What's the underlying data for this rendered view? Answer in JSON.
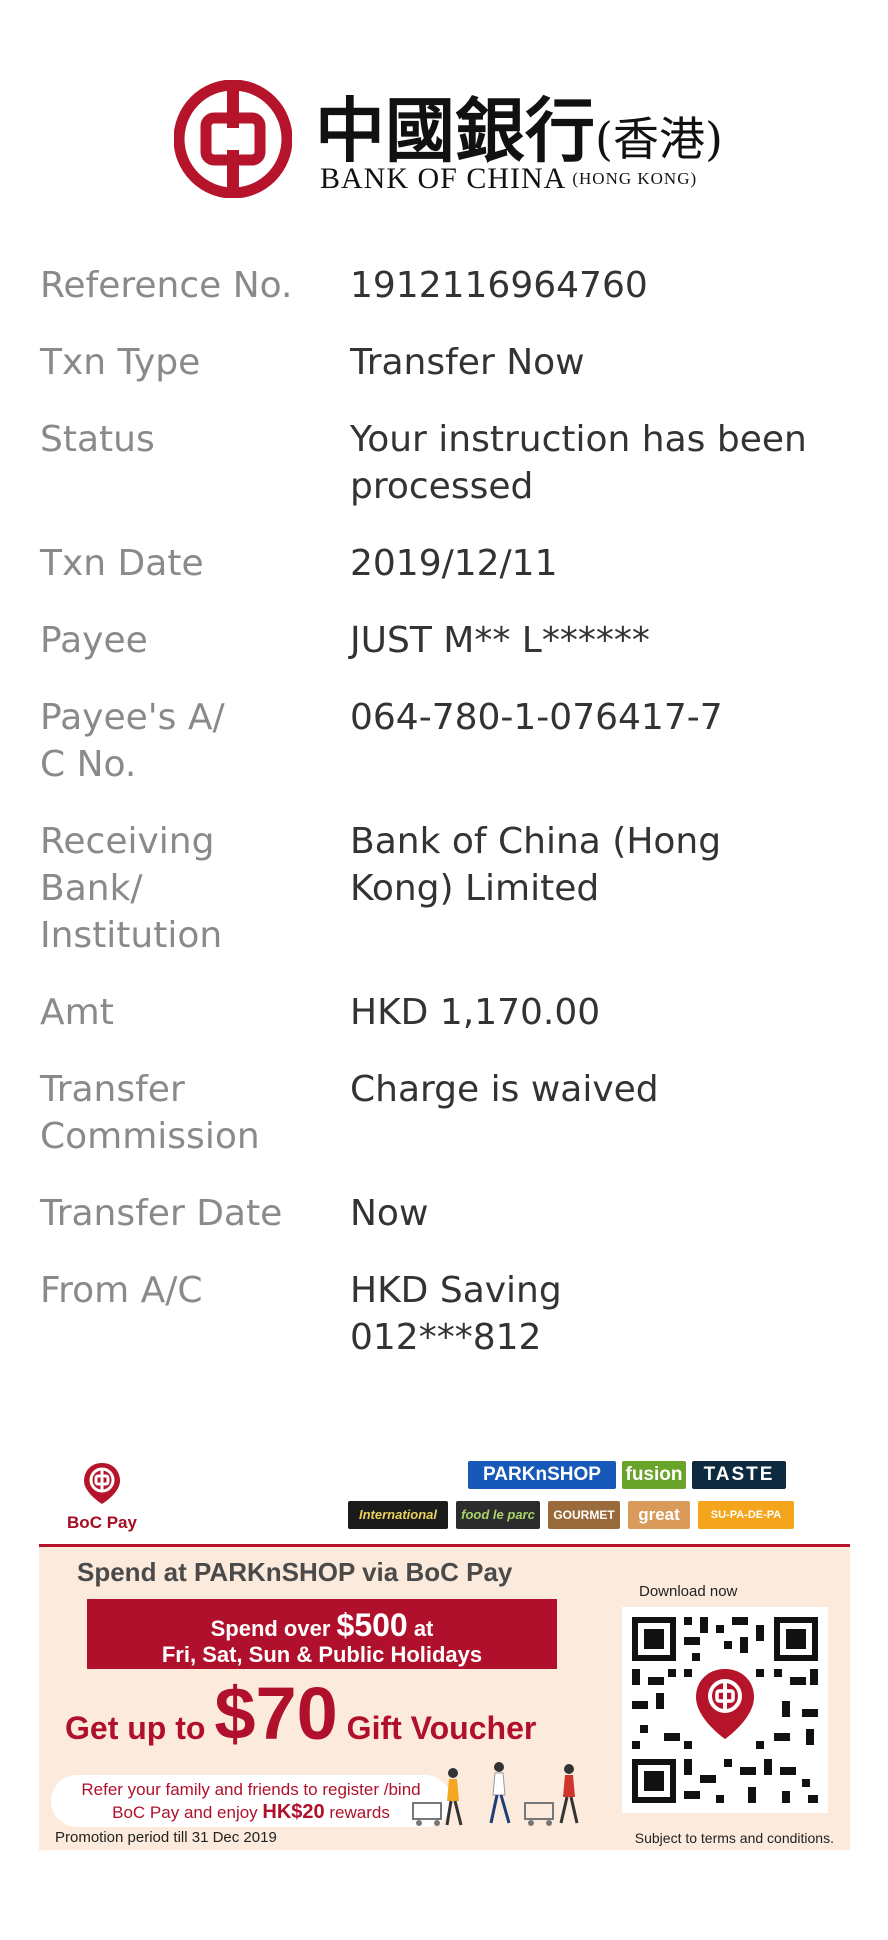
{
  "header": {
    "logo_cn": "中國銀行",
    "logo_cn_sub": "(香港)",
    "logo_en": "BANK OF CHINA",
    "logo_en_sub": "(HONG KONG)"
  },
  "details": [
    {
      "label": "Reference No.",
      "value": "1912116964760"
    },
    {
      "label": "Txn Type",
      "value": "Transfer Now"
    },
    {
      "label": "Status",
      "value": "Your instruction has been processed"
    },
    {
      "label": "Txn Date",
      "value": "2019/12/11"
    },
    {
      "label": "Payee",
      "value": "JUST M** L******"
    },
    {
      "label": "Payee's A/ C No.",
      "value": "064-780-1-076417-7"
    },
    {
      "label": "Receiving Bank/ Institution",
      "value": "Bank of China (Hong Kong) Limited"
    },
    {
      "label": "Amt",
      "value": "HKD 1,170.00"
    },
    {
      "label": "Transfer Commission",
      "value": "Charge is waived"
    },
    {
      "label": "Transfer Date",
      "value": "Now"
    },
    {
      "label": "From A/C",
      "value": "HKD Saving 012***812"
    }
  ],
  "banner": {
    "bocpay_label": "BoC Pay",
    "brands": [
      "PARKnSHOP",
      "fusion",
      "TASTE",
      "International",
      "food le parc",
      "GOURMET",
      "great",
      "SU-PA-DE-PA"
    ],
    "headline": "Spend at PARKnSHOP via BoC Pay",
    "promo_line1_pre": "Spend over ",
    "promo_line1_amount": "$500",
    "promo_line1_post": " at",
    "promo_line2": "Fri, Sat, Sun & Public Holidays",
    "gift_pre": "Get up to ",
    "gift_amount": "$70",
    "gift_post": " Gift Voucher",
    "refer_line1": "Refer your family and friends to register /bind",
    "refer_line2_pre": "BoC Pay and enjoy ",
    "refer_line2_amount": "HK$20",
    "refer_line2_post": " rewards",
    "promo_period": "Promotion period till 31 Dec 2019",
    "download": "Download now",
    "terms": "Subject to terms and conditions.",
    "colors": {
      "brand_red": "#b0102b",
      "banner_bg": "#fcebdc"
    }
  }
}
